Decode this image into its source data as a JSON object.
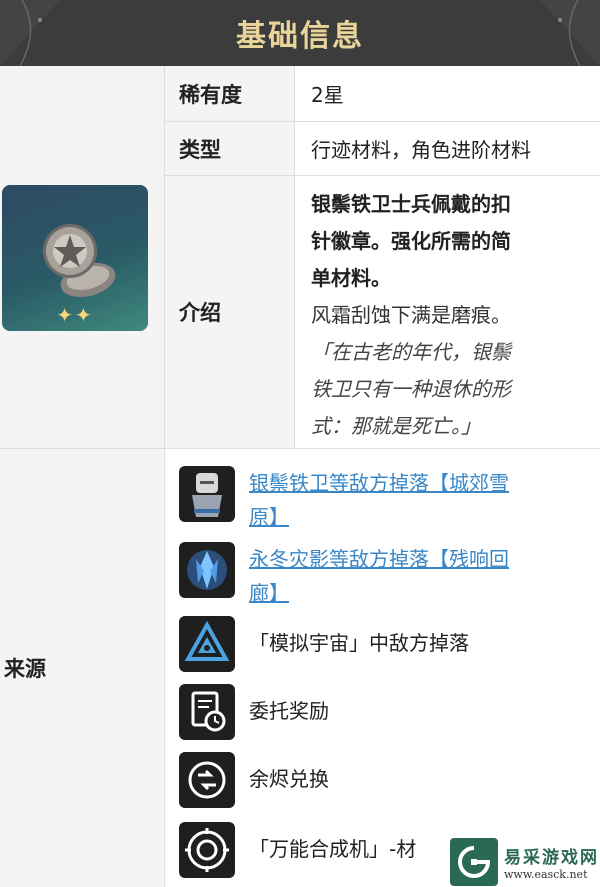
{
  "header": {
    "title": "基础信息"
  },
  "item": {
    "stars": "✦✦"
  },
  "rows": {
    "rarity": {
      "label": "稀有度",
      "value": "2星"
    },
    "type": {
      "label": "类型",
      "value": "行迹材料，角色进阶材料"
    },
    "intro": {
      "label": "介绍",
      "bold": [
        "银鬃铁卫士兵佩戴的扣",
        "针徽章。强化所需的简",
        "单材料。"
      ],
      "plain": "风霜刮蚀下满是磨痕。",
      "italic": [
        "「在古老的年代，银鬃",
        "铁卫只有一种退休的形",
        "式：那就是死亡。」"
      ]
    }
  },
  "source": {
    "label": "来源",
    "items": [
      {
        "lines": [
          "银鬃铁卫等敌方掉落【城郊雪",
          "原】"
        ],
        "icon": "silvermane-soldier-icon",
        "link": true
      },
      {
        "lines": [
          "永冬灾影等敌方掉落【残响回",
          "廊】"
        ],
        "icon": "ice-crystal-icon",
        "link": true
      },
      {
        "lines": [
          "「模拟宇宙」中敌方掉落"
        ],
        "icon": "simulated-universe-icon",
        "link": false
      },
      {
        "lines": [
          "委托奖励"
        ],
        "icon": "assignment-icon",
        "link": false
      },
      {
        "lines": [
          "余烬兑换"
        ],
        "icon": "embers-exchange-icon",
        "link": false
      },
      {
        "lines": [
          "「万能合成机」-材"
        ],
        "icon": "synthesizer-icon",
        "link": false
      }
    ]
  },
  "watermark": {
    "name": "易采游戏网",
    "url": "www.easck.net"
  },
  "colors": {
    "header_bg": "#3c3c3c",
    "header_text": "#e9d49a",
    "link": "#3a87c7",
    "label_bg": "#f4f4f4"
  }
}
